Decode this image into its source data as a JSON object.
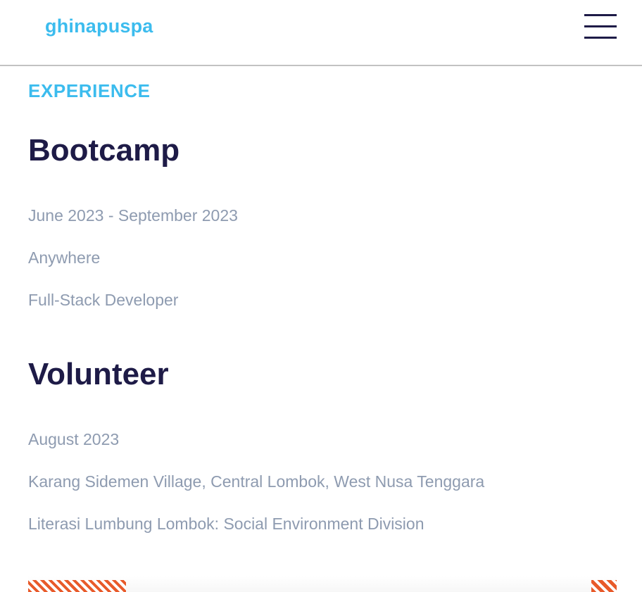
{
  "header": {
    "logo_text": "ghinapuspa",
    "menu_icon": "hamburger-menu-icon"
  },
  "experience": {
    "section_label": "EXPERIENCE",
    "entries": [
      {
        "title": "Bootcamp",
        "period": "June 2023 - September 2023",
        "location": "Anywhere",
        "role": "Full-Stack Developer"
      },
      {
        "title": "Volunteer",
        "period": "August 2023",
        "location": "Karang Sidemen Village, Central Lombok, West Nusa Tenggara",
        "role": "Literasi Lumbung Lombok: Social Environment Division"
      }
    ]
  },
  "colors": {
    "accent": "#3cbcee",
    "heading": "#1e1b47",
    "body_text": "#8e9bb0",
    "stripe": "#e85a2a",
    "divider": "#c2c2c2"
  }
}
